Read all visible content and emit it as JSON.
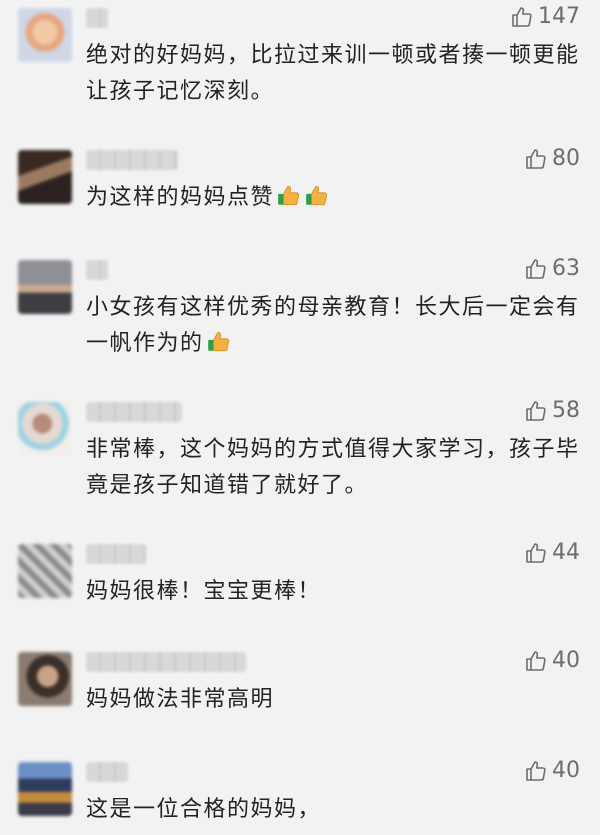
{
  "comments": [
    {
      "likes": "147",
      "text": "绝对的好妈妈，比拉过来训一顿或者揍一顿更能让孩子记忆深刻。",
      "emoji_count": 0
    },
    {
      "likes": "80",
      "text": "为这样的妈妈点赞",
      "emoji_count": 2
    },
    {
      "likes": "63",
      "text": "小女孩有这样优秀的母亲教育！长大后一定会有一帆作为的",
      "emoji_count": 1
    },
    {
      "likes": "58",
      "text": "非常棒，这个妈妈的方式值得大家学习，孩子毕竟是孩子知道错了就好了。",
      "emoji_count": 0
    },
    {
      "likes": "44",
      "text": "妈妈很棒！宝宝更棒！",
      "emoji_count": 0
    },
    {
      "likes": "40",
      "text": "妈妈做法非常高明",
      "emoji_count": 0
    },
    {
      "likes": "40",
      "text": "这是一位合格的妈妈，",
      "emoji_count": 0
    }
  ],
  "icons": {
    "like": "thumbs-up-outline-icon",
    "emoji": "thumbs-up-emoji-icon"
  },
  "colors": {
    "background": "#f2f2f2",
    "like_text": "#6d6d6d",
    "emoji": "#f3b043"
  }
}
